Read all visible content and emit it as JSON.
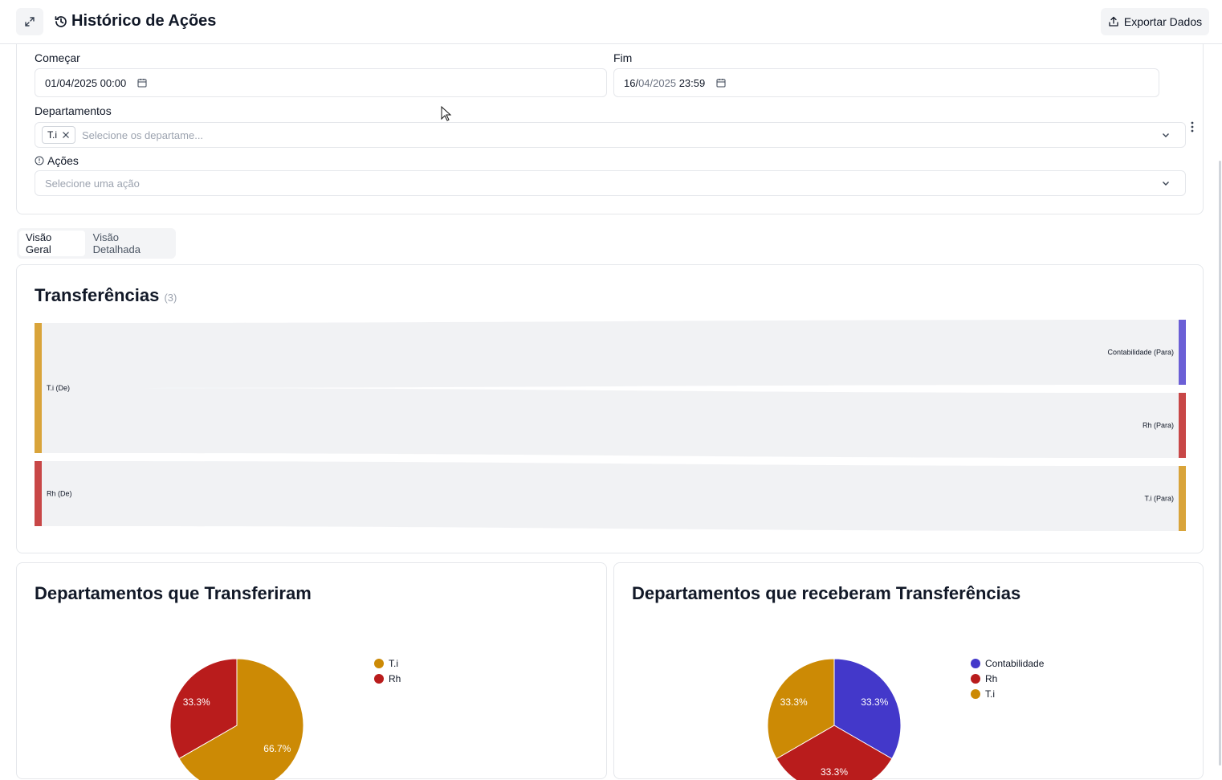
{
  "header": {
    "title": "Histórico de Ações",
    "export_label": "Exportar Dados"
  },
  "filters": {
    "start_label": "Começar",
    "start_value": "01/04/2025 00:00",
    "end_label": "Fim",
    "end_value_day": "16/",
    "end_value_monthyear": "04/2025",
    "end_value_time": "23:59",
    "departments_label": "Departamentos",
    "departments_tag": "T.i",
    "departments_placeholder": "Selecione os departame...",
    "actions_label": "Ações",
    "actions_placeholder": "Selecione uma ação"
  },
  "tabs": [
    {
      "label": "Visão Geral"
    },
    {
      "label": "Visão Detalhada"
    }
  ],
  "transfers": {
    "title": "Transferências",
    "count": "(3)",
    "source_nodes": [
      {
        "label": "T.i (De)",
        "color": "#d9a43a"
      },
      {
        "label": "Rh (De)",
        "color": "#c84747"
      }
    ],
    "target_nodes": [
      {
        "label": "Contabilidade (Para)",
        "color": "#6b5fd6"
      },
      {
        "label": "Rh (Para)",
        "color": "#c84747"
      },
      {
        "label": "T.i (Para)",
        "color": "#d9a43a"
      }
    ],
    "links": [
      {
        "from": "T.i (De)",
        "to": "Contabilidade (Para)",
        "value": 1
      },
      {
        "from": "T.i (De)",
        "to": "Rh (Para)",
        "value": 1
      },
      {
        "from": "Rh (De)",
        "to": "T.i (Para)",
        "value": 1
      }
    ]
  },
  "chart_data": [
    {
      "type": "pie",
      "title": "Departamentos que Transferiram",
      "labels": [
        "T.i",
        "Rh"
      ],
      "values": [
        66.7,
        33.3
      ],
      "value_labels": [
        "66.7%",
        "33.3%"
      ],
      "colors": [
        "#cc8a05",
        "#b91c1c"
      ],
      "legend": "right"
    },
    {
      "type": "pie",
      "title": "Departamentos que receberam Transferências",
      "labels": [
        "Contabilidade",
        "Rh",
        "T.i"
      ],
      "values": [
        33.3,
        33.3,
        33.3
      ],
      "value_labels": [
        "33.3%",
        "33.3%",
        "33.3%"
      ],
      "colors": [
        "#4338ca",
        "#b91c1c",
        "#cc8a05"
      ],
      "legend": "right"
    }
  ]
}
